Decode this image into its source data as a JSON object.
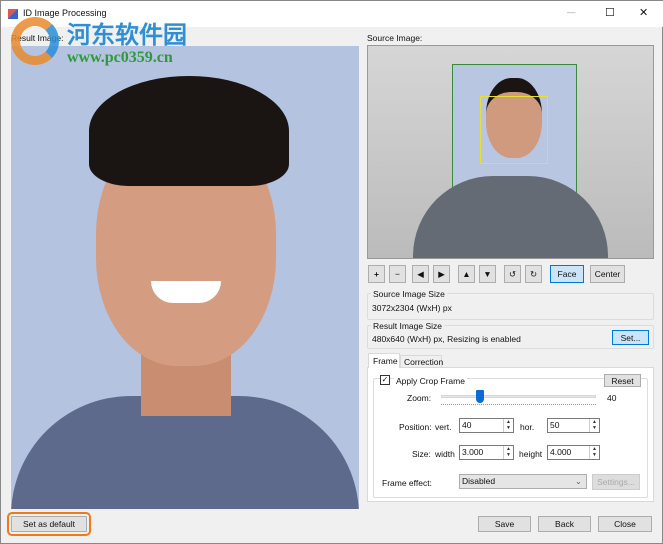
{
  "window": {
    "title": "ID Image Processing",
    "minimize": "—",
    "maximize": "☐",
    "close": "✕"
  },
  "watermark": {
    "name": "河东软件园",
    "url": "www.pc0359.cn"
  },
  "result": {
    "label": "Result Image:"
  },
  "source": {
    "label": "Source Image:"
  },
  "toolbar": {
    "plus": "+",
    "minus": "−",
    "left": "◀",
    "right": "▶",
    "up": "▲",
    "down": "▼",
    "rot_ccw": "↺",
    "rot_cw": "↻",
    "face": "Face",
    "center": "Center"
  },
  "source_size": {
    "title": "Source Image Size",
    "value": "3072x2304 (WxH) px"
  },
  "result_size": {
    "title": "Result Image Size",
    "value": "480x640 (WxH) px, Resizing is enabled",
    "set": "Set..."
  },
  "tabs": [
    {
      "label": "Frame"
    },
    {
      "label": "Correction"
    }
  ],
  "frame": {
    "apply_label": "Apply Crop Frame",
    "apply_checked": true,
    "reset": "Reset",
    "zoom_label": "Zoom:",
    "zoom_value": "40",
    "zoom_fraction": 0.2,
    "position_label": "Position:",
    "vert_label": "vert.",
    "vert": "40",
    "hor_label": "hor.",
    "hor": "50",
    "size_label": "Size:",
    "width_label": "width",
    "width": "3.000",
    "height_label": "height",
    "height": "4.000",
    "effect_label": "Frame effect:",
    "effect": "Disabled",
    "settings": "Settings..."
  },
  "footer": {
    "set_default": "Set as default",
    "save": "Save",
    "back": "Back",
    "close": "Close"
  }
}
